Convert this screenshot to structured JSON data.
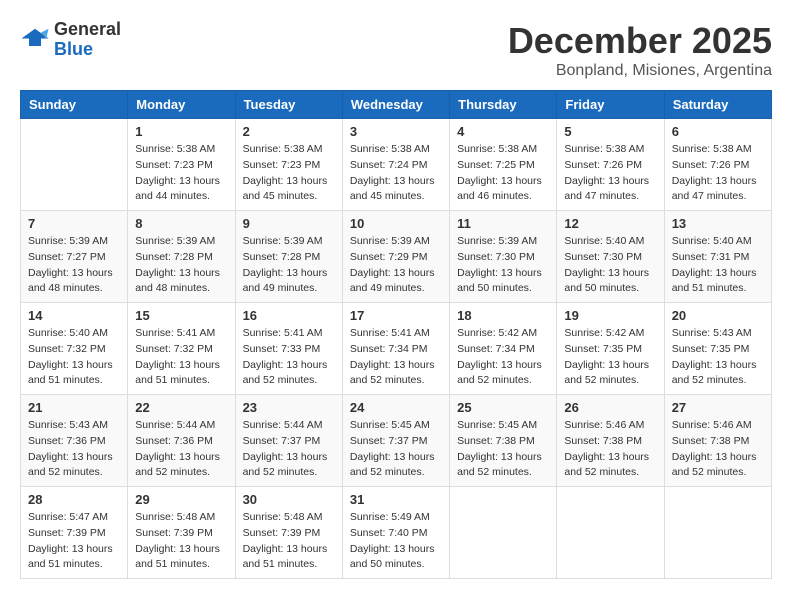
{
  "header": {
    "logo_general": "General",
    "logo_blue": "Blue",
    "month_title": "December 2025",
    "location": "Bonpland, Misiones, Argentina"
  },
  "weekdays": [
    "Sunday",
    "Monday",
    "Tuesday",
    "Wednesday",
    "Thursday",
    "Friday",
    "Saturday"
  ],
  "weeks": [
    [
      {
        "day": null,
        "info": null
      },
      {
        "day": "1",
        "info": "Sunrise: 5:38 AM\nSunset: 7:23 PM\nDaylight: 13 hours\nand 44 minutes."
      },
      {
        "day": "2",
        "info": "Sunrise: 5:38 AM\nSunset: 7:23 PM\nDaylight: 13 hours\nand 45 minutes."
      },
      {
        "day": "3",
        "info": "Sunrise: 5:38 AM\nSunset: 7:24 PM\nDaylight: 13 hours\nand 45 minutes."
      },
      {
        "day": "4",
        "info": "Sunrise: 5:38 AM\nSunset: 7:25 PM\nDaylight: 13 hours\nand 46 minutes."
      },
      {
        "day": "5",
        "info": "Sunrise: 5:38 AM\nSunset: 7:26 PM\nDaylight: 13 hours\nand 47 minutes."
      },
      {
        "day": "6",
        "info": "Sunrise: 5:38 AM\nSunset: 7:26 PM\nDaylight: 13 hours\nand 47 minutes."
      }
    ],
    [
      {
        "day": "7",
        "info": "Sunrise: 5:39 AM\nSunset: 7:27 PM\nDaylight: 13 hours\nand 48 minutes."
      },
      {
        "day": "8",
        "info": "Sunrise: 5:39 AM\nSunset: 7:28 PM\nDaylight: 13 hours\nand 48 minutes."
      },
      {
        "day": "9",
        "info": "Sunrise: 5:39 AM\nSunset: 7:28 PM\nDaylight: 13 hours\nand 49 minutes."
      },
      {
        "day": "10",
        "info": "Sunrise: 5:39 AM\nSunset: 7:29 PM\nDaylight: 13 hours\nand 49 minutes."
      },
      {
        "day": "11",
        "info": "Sunrise: 5:39 AM\nSunset: 7:30 PM\nDaylight: 13 hours\nand 50 minutes."
      },
      {
        "day": "12",
        "info": "Sunrise: 5:40 AM\nSunset: 7:30 PM\nDaylight: 13 hours\nand 50 minutes."
      },
      {
        "day": "13",
        "info": "Sunrise: 5:40 AM\nSunset: 7:31 PM\nDaylight: 13 hours\nand 51 minutes."
      }
    ],
    [
      {
        "day": "14",
        "info": "Sunrise: 5:40 AM\nSunset: 7:32 PM\nDaylight: 13 hours\nand 51 minutes."
      },
      {
        "day": "15",
        "info": "Sunrise: 5:41 AM\nSunset: 7:32 PM\nDaylight: 13 hours\nand 51 minutes."
      },
      {
        "day": "16",
        "info": "Sunrise: 5:41 AM\nSunset: 7:33 PM\nDaylight: 13 hours\nand 52 minutes."
      },
      {
        "day": "17",
        "info": "Sunrise: 5:41 AM\nSunset: 7:34 PM\nDaylight: 13 hours\nand 52 minutes."
      },
      {
        "day": "18",
        "info": "Sunrise: 5:42 AM\nSunset: 7:34 PM\nDaylight: 13 hours\nand 52 minutes."
      },
      {
        "day": "19",
        "info": "Sunrise: 5:42 AM\nSunset: 7:35 PM\nDaylight: 13 hours\nand 52 minutes."
      },
      {
        "day": "20",
        "info": "Sunrise: 5:43 AM\nSunset: 7:35 PM\nDaylight: 13 hours\nand 52 minutes."
      }
    ],
    [
      {
        "day": "21",
        "info": "Sunrise: 5:43 AM\nSunset: 7:36 PM\nDaylight: 13 hours\nand 52 minutes."
      },
      {
        "day": "22",
        "info": "Sunrise: 5:44 AM\nSunset: 7:36 PM\nDaylight: 13 hours\nand 52 minutes."
      },
      {
        "day": "23",
        "info": "Sunrise: 5:44 AM\nSunset: 7:37 PM\nDaylight: 13 hours\nand 52 minutes."
      },
      {
        "day": "24",
        "info": "Sunrise: 5:45 AM\nSunset: 7:37 PM\nDaylight: 13 hours\nand 52 minutes."
      },
      {
        "day": "25",
        "info": "Sunrise: 5:45 AM\nSunset: 7:38 PM\nDaylight: 13 hours\nand 52 minutes."
      },
      {
        "day": "26",
        "info": "Sunrise: 5:46 AM\nSunset: 7:38 PM\nDaylight: 13 hours\nand 52 minutes."
      },
      {
        "day": "27",
        "info": "Sunrise: 5:46 AM\nSunset: 7:38 PM\nDaylight: 13 hours\nand 52 minutes."
      }
    ],
    [
      {
        "day": "28",
        "info": "Sunrise: 5:47 AM\nSunset: 7:39 PM\nDaylight: 13 hours\nand 51 minutes."
      },
      {
        "day": "29",
        "info": "Sunrise: 5:48 AM\nSunset: 7:39 PM\nDaylight: 13 hours\nand 51 minutes."
      },
      {
        "day": "30",
        "info": "Sunrise: 5:48 AM\nSunset: 7:39 PM\nDaylight: 13 hours\nand 51 minutes."
      },
      {
        "day": "31",
        "info": "Sunrise: 5:49 AM\nSunset: 7:40 PM\nDaylight: 13 hours\nand 50 minutes."
      },
      {
        "day": null,
        "info": null
      },
      {
        "day": null,
        "info": null
      },
      {
        "day": null,
        "info": null
      }
    ]
  ]
}
